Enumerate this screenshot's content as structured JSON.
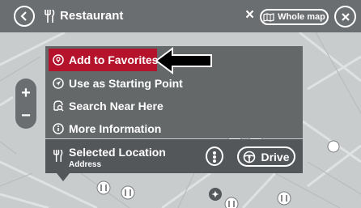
{
  "header": {
    "title": "Restaurant",
    "clear_label": "×",
    "whole_map_label": "Whole map"
  },
  "map": {
    "zoom_in_label": "+",
    "zoom_out_label": "−"
  },
  "context_menu": {
    "items": [
      {
        "label": "Add to Favorites",
        "icon": "favorite-icon",
        "highlighted": true
      },
      {
        "label": "Use as Starting Point",
        "icon": "navigation-arrow-icon",
        "highlighted": false
      },
      {
        "label": "Search Near Here",
        "icon": "search-near-icon",
        "highlighted": false
      },
      {
        "label": "More Information",
        "icon": "info-icon",
        "highlighted": false
      }
    ]
  },
  "selected_location": {
    "title": "Selected Location",
    "subtitle": "Address",
    "drive_label": "Drive"
  },
  "colors": {
    "highlight": "#b5122b",
    "bar": "#6b6e70",
    "map": "#c9cccd"
  }
}
